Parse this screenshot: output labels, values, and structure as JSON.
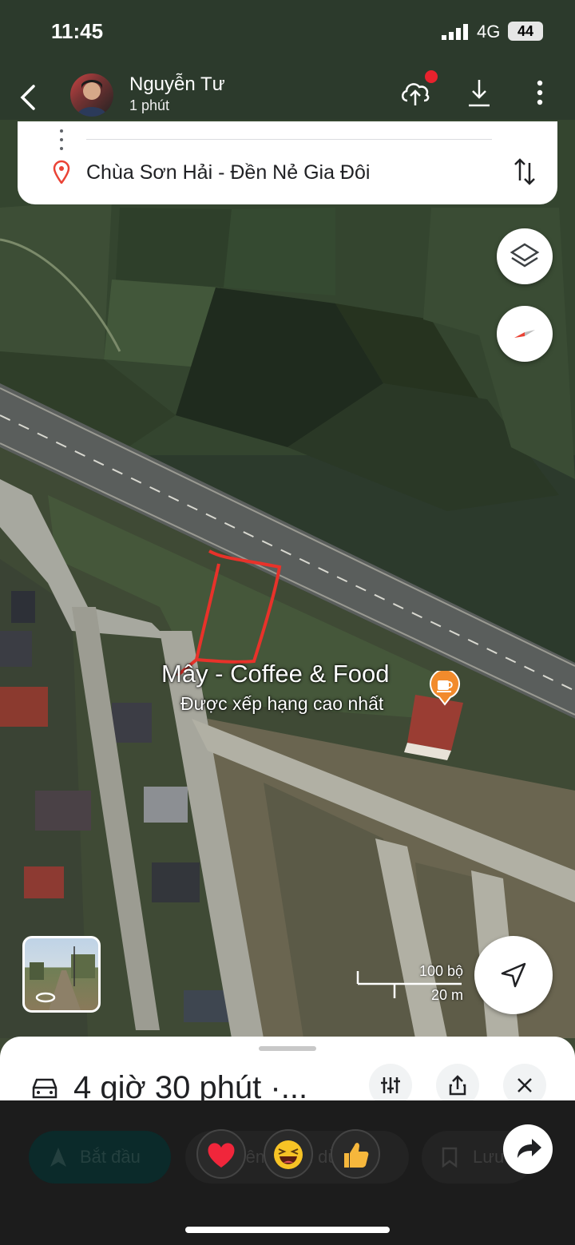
{
  "status_bar": {
    "time": "11:45",
    "network": "4G",
    "battery": "44"
  },
  "chat_header": {
    "contact_name": "Nguyễn Tư",
    "last_active": "1 phút"
  },
  "route": {
    "destination": "Chùa Sơn Hải - Đền Nẻ Gia Đôi"
  },
  "map": {
    "place_name": "Mây - Coffee & Food",
    "place_subtitle": "Được xếp hạng cao nhất",
    "scale_imperial": "100 bộ",
    "scale_metric": "20 m",
    "highlight_color": "#e8322a"
  },
  "sheet": {
    "duration": "4 giờ 30 phút ·..."
  },
  "actions": {
    "start_label": "Bắt đầu",
    "add_stop_label": "Thêm điểm dừng",
    "save_label": "Lưu"
  },
  "reactions": [
    "heart",
    "laughing",
    "thumbs-up"
  ]
}
